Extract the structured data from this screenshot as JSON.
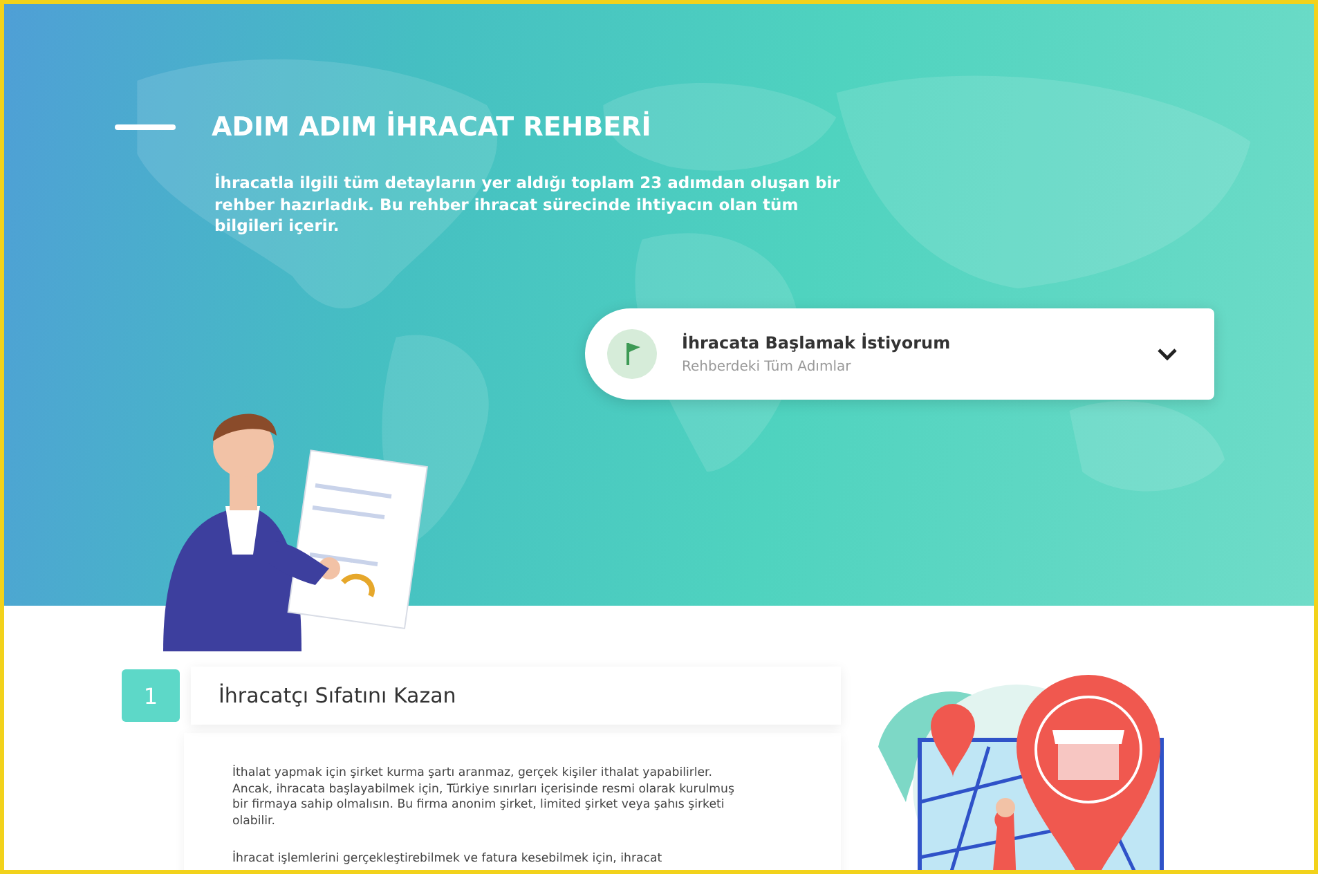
{
  "hero": {
    "title": "ADIM ADIM İHRACAT REHBERİ",
    "description": "İhracatla ilgili tüm detayların yer aldığı toplam 23 adımdan oluşan bir rehber hazırladık. Bu rehber ihracat sürecinde ihtiyacın olan tüm bilgileri içerir.",
    "selector": {
      "title": "İhracata Başlamak İstiyorum",
      "subtitle": "Rehberdeki Tüm Adımlar",
      "expanded": false
    }
  },
  "steps": [
    {
      "number": "1",
      "title": "İhracatçı Sıfatını Kazan",
      "paragraphs": [
        "İthalat yapmak için şirket kurma şartı aranmaz, gerçek kişiler ithalat yapabilirler. Ancak, ihracata başlayabilmek için, Türkiye sınırları içerisinde resmi olarak kurulmuş bir firmaya sahip olmalısın. Bu firma anonim şirket, limited şirket veya şahıs şirketi olabilir.",
        "İhracat işlemlerini gerçekleştirebilmek ve fatura kesebilmek için, ihracat"
      ]
    }
  ]
}
